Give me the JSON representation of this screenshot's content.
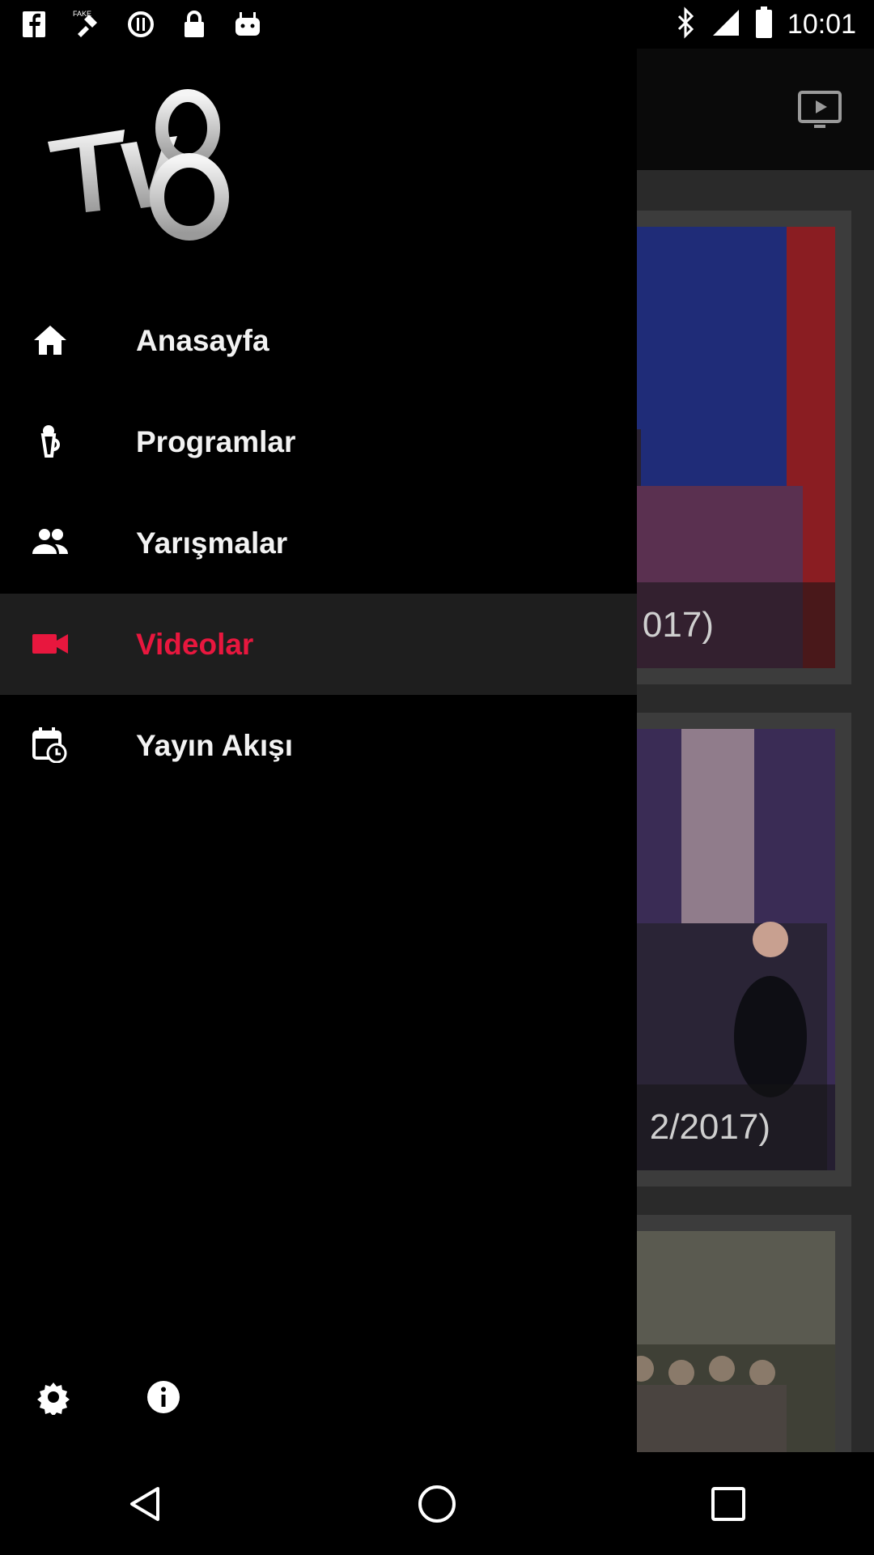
{
  "status_bar": {
    "time": "10:01",
    "icons": [
      "facebook-icon",
      "fake-gps-icon",
      "data-saver-icon",
      "lock-icon",
      "android-icon"
    ],
    "right_icons": [
      "bluetooth-icon",
      "signal-icon",
      "battery-icon"
    ]
  },
  "header": {
    "cast_icon": "cast-icon"
  },
  "drawer": {
    "logo_alt": "TV8",
    "menu": [
      {
        "label": "Anasayfa",
        "icon": "home-icon"
      },
      {
        "label": "Programlar",
        "icon": "microphone-icon"
      },
      {
        "label": "Yarışmalar",
        "icon": "people-icon"
      },
      {
        "label": "Videolar",
        "icon": "videocam-icon",
        "active": true
      },
      {
        "label": "Yayın Akışı",
        "icon": "calendar-clock-icon"
      }
    ],
    "footer": {
      "settings_icon": "gear-icon",
      "info_icon": "info-icon"
    }
  },
  "cards": [
    {
      "caption": "017)"
    },
    {
      "caption": "2/2017)"
    },
    {
      "caption": ""
    }
  ],
  "colors": {
    "accent": "#e8173e",
    "drawer_bg": "#000000",
    "active_bg": "#1e1e1e"
  },
  "nav": [
    "back-icon",
    "home-circle-icon",
    "recents-icon"
  ]
}
